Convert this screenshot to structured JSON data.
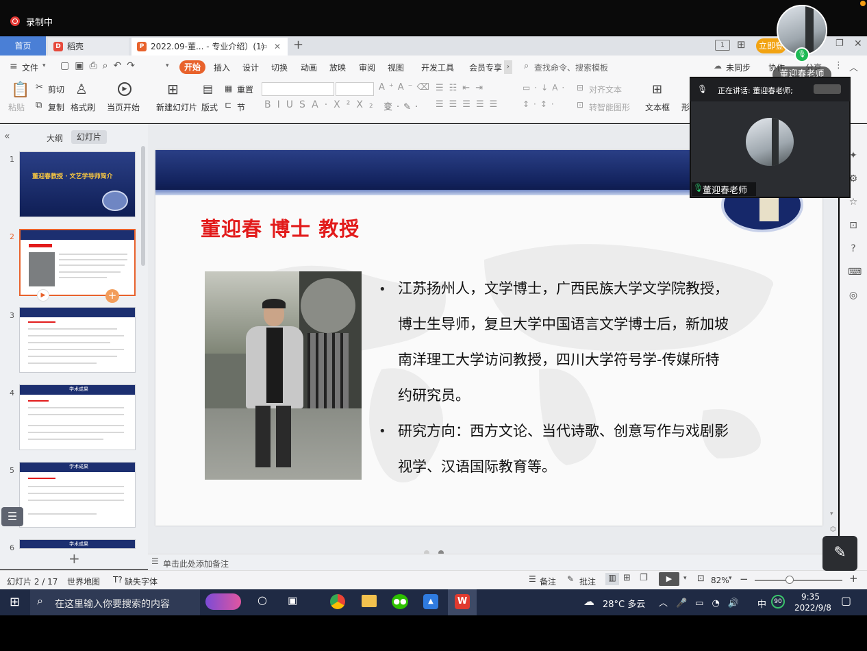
{
  "recording": {
    "label": "录制中"
  },
  "tabs": {
    "home": "首页",
    "docer": "稻壳",
    "file": "2022.09-董... - 专业介绍）(1)"
  },
  "menu": {
    "file": "文件",
    "items": [
      "开始",
      "插入",
      "设计",
      "切换",
      "动画",
      "放映",
      "审阅",
      "视图",
      "开发工具",
      "会员专享"
    ],
    "active": "开始",
    "search": "查找命令、搜索模板",
    "sync": "未同步",
    "collab": "协作",
    "share": "分享",
    "upgrade": "立即登"
  },
  "ribbon": {
    "paste": "粘贴",
    "cut": "剪切",
    "copy": "复制",
    "format_painter": "格式刷",
    "play_current": "当页开始",
    "new_slide": "新建幻灯片",
    "layout": "版式",
    "reset": "重置",
    "section": "节",
    "align_text": "对齐文本",
    "smart_shape": "转智能图形",
    "textbox": "文本框",
    "shape": "形"
  },
  "panel": {
    "tab_outline": "大纲",
    "tab_slides": "幻灯片",
    "thumb1_title": "董迎春教授 · 文艺学导师简介",
    "thumb_cards": [
      "学术成果",
      "学术成果",
      "学术成果"
    ],
    "slide_numbers": [
      "1",
      "2",
      "3",
      "4",
      "5",
      "6"
    ]
  },
  "slide": {
    "title": "董迎春  博士  教授",
    "bullets": [
      [
        "江苏扬州人，文学博士，广西民族大学文学院教授，",
        "博士生导师，复旦大学中国语言文学博士后，新加坡",
        "南洋理工大学访问教授，四川大学符号学-传媒所特",
        "约研究员。"
      ],
      [
        "研究方向：西方文论、当代诗歌、创意写作与戏剧影",
        "视学、汉语国际教育等。"
      ]
    ]
  },
  "notes": {
    "placeholder": "单击此处添加备注"
  },
  "status": {
    "slide_count": "幻灯片 2 / 17",
    "theme": "世界地图",
    "missing_font": "缺失字体",
    "notes_btn": "备注",
    "comments_btn": "批注",
    "zoom": "82%"
  },
  "meeting": {
    "speaker_name": "董迎春老师",
    "speaking_label": "正在讲话: 董迎春老师;",
    "cam_label": "董迎春老师"
  },
  "taskbar": {
    "search": "在这里输入你要搜索的内容",
    "weather": "28°C 多云",
    "ime": "中",
    "battery": "90",
    "time": "9:35",
    "date": "2022/9/8"
  }
}
